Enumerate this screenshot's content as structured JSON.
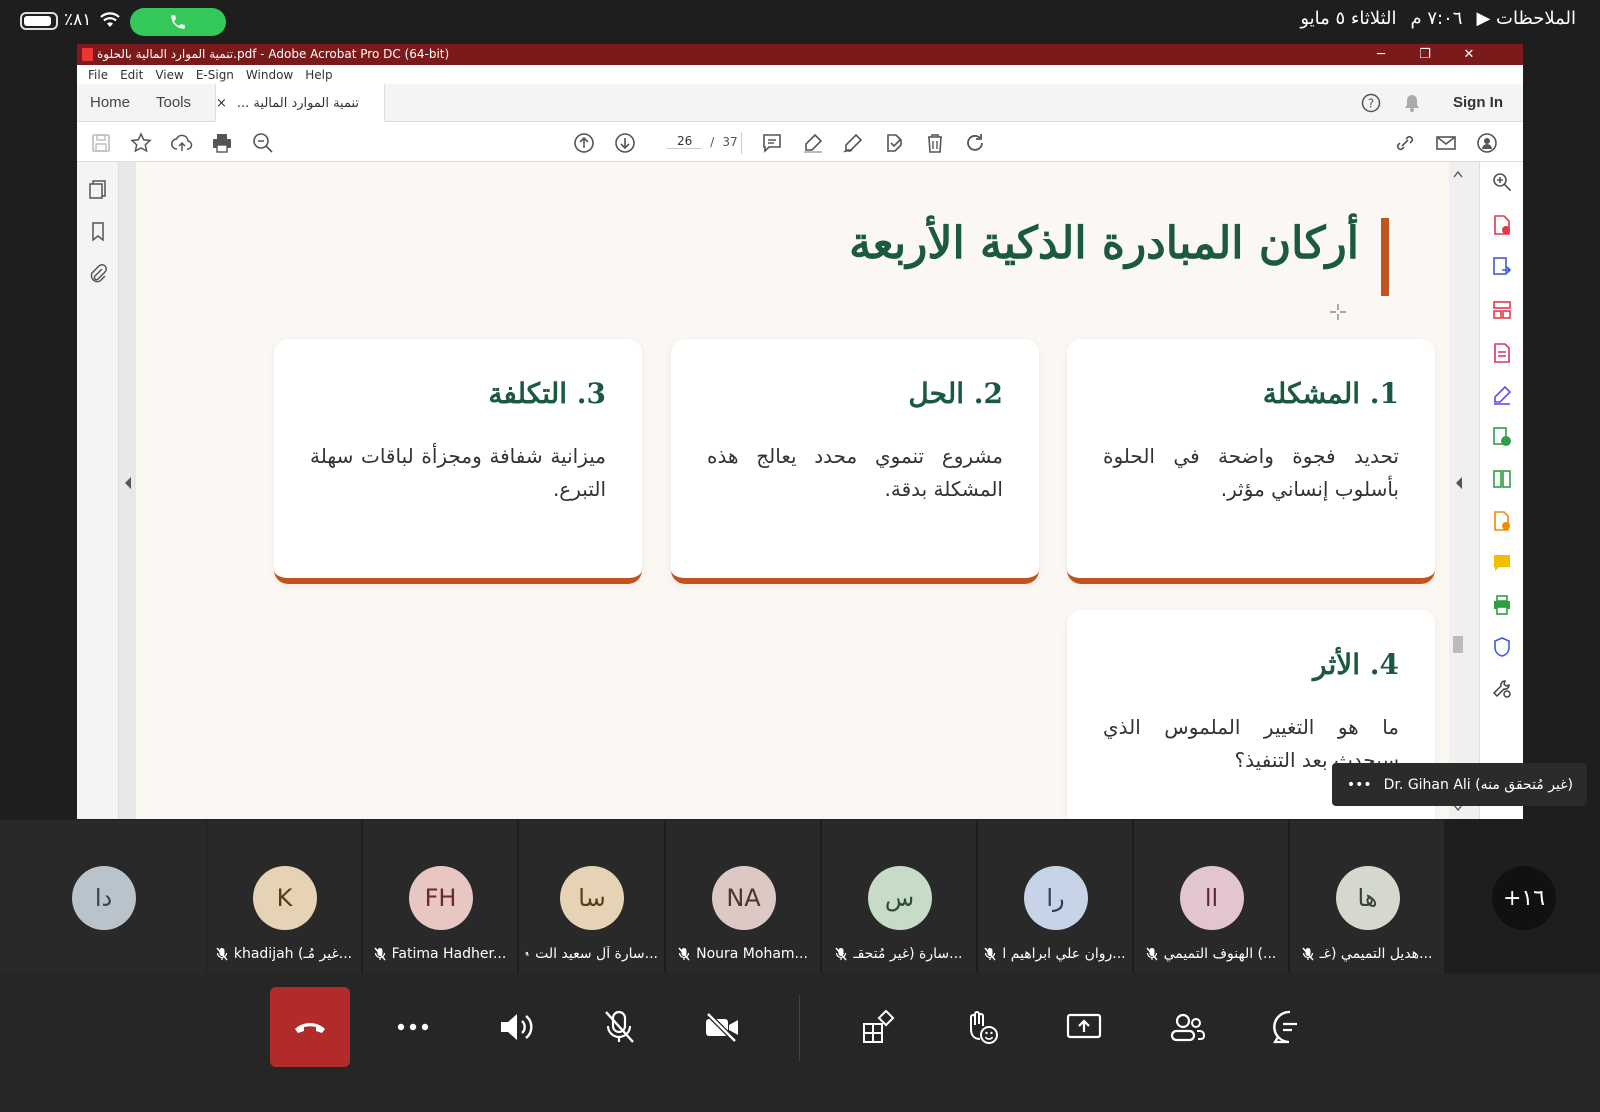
{
  "status_bar": {
    "battery_pct": "٪٨١",
    "time": "٧:٠٦ م",
    "date": "الثلاثاء ٥ مايو",
    "app": "الملاحظات ▶"
  },
  "acrobat": {
    "window_title": "تنمية الموارد المالية بالحلوة.pdf - Adobe Acrobat Pro DC (64-bit)",
    "menu": [
      "File",
      "Edit",
      "View",
      "E-Sign",
      "Window",
      "Help"
    ],
    "tabs": {
      "home": "Home",
      "tools": "Tools",
      "doc": "تنمية الموارد المالية ...",
      "close": "×"
    },
    "sign_in": "Sign In",
    "page_current": "26",
    "page_sep": "/",
    "page_total": "37"
  },
  "slide": {
    "heading": "أركان المبادرة الذكية الأربعة",
    "cards": [
      {
        "title": "1. المشكلة",
        "text": "تحديد فجوة واضحة في الحلوة بأسلوب إنساني مؤثر."
      },
      {
        "title": "2. الحل",
        "text": "مشروع تنموي محدد يعالج هذه المشكلة بدقة."
      },
      {
        "title": "3. التكلفة",
        "text": "ميزانية شفافة ومجزأة لباقات سهلة التبرع."
      },
      {
        "title": "4. الأثر",
        "text": "ما هو التغيير الملموس الذي سيحدث بعد التنفيذ؟"
      }
    ]
  },
  "speaker": {
    "name": "Dr. Gihan Ali (غير مُتحقق منه)",
    "more": "•••"
  },
  "participants": [
    {
      "initials": "دا",
      "name": "",
      "color": "#b9c3cc",
      "text_color": "#3a4350"
    },
    {
      "initials": "K",
      "name": "khadijah  (غير مُـ...",
      "color": "#e6d2b5",
      "text_color": "#5a3c14"
    },
    {
      "initials": "FH",
      "name": "Fatima Hadher...",
      "color": "#e8c7c2",
      "text_color": "#6a2c24"
    },
    {
      "initials": "سا",
      "name": "سارة آل سعيد الت...",
      "color": "#e6d2b5",
      "text_color": "#5a3c14"
    },
    {
      "initials": "NA",
      "name": "Noura Moham...",
      "color": "#ddc9c4",
      "text_color": "#4a3530"
    },
    {
      "initials": "س",
      "name": "سارة  (غير مُتحقـ...",
      "color": "#c6dcc8",
      "text_color": "#2e4c33"
    },
    {
      "initials": "را",
      "name": "روان علي ابراهيم ا...",
      "color": "#c7d3e6",
      "text_color": "#2e3d58"
    },
    {
      "initials": "اا",
      "name": "الهنوف التميمي (...",
      "color": "#e3c5cf",
      "text_color": "#5e2a3a"
    },
    {
      "initials": "ها",
      "name": "هديل التميمي (غـ...",
      "color": "#d4d8cf",
      "text_color": "#3c4236"
    }
  ],
  "more_participants": "+١٦",
  "colors": {
    "accent_green": "#1c5a40",
    "accent_orange": "#c0531e",
    "end_call": "#b22b2b",
    "call_pill": "#34c759"
  }
}
